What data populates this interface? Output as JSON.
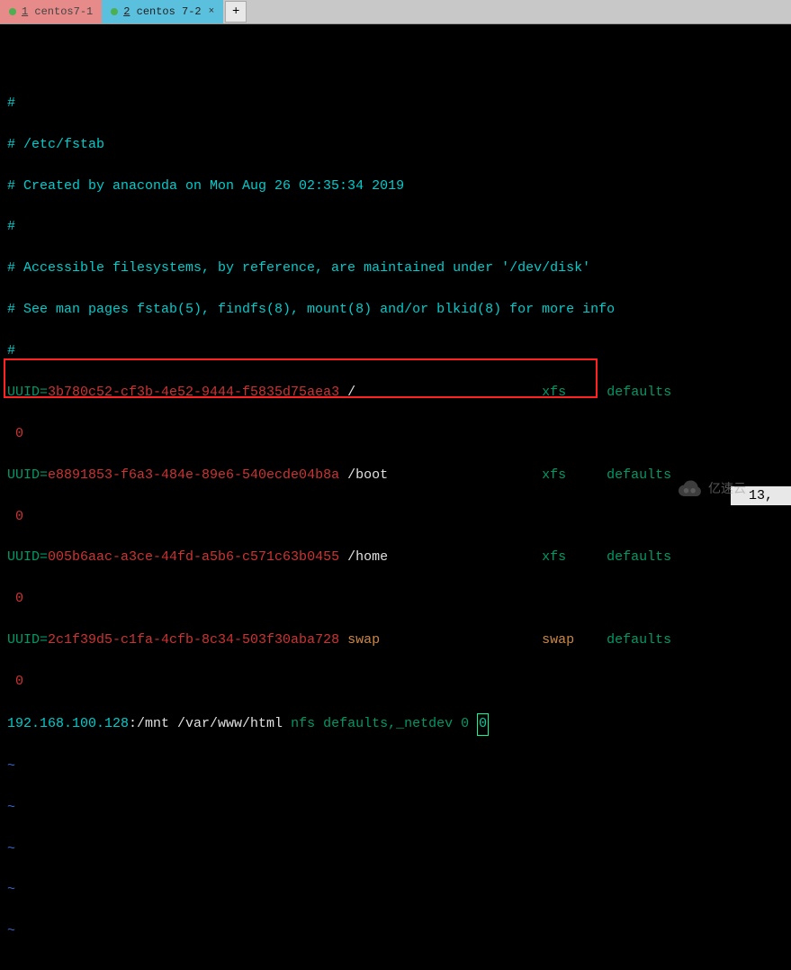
{
  "tabs": {
    "inactive": {
      "num": "1",
      "label": " centos7-1"
    },
    "active": {
      "num": "2",
      "label": " centos 7-2"
    },
    "add": "+"
  },
  "fstab": {
    "h1": "#",
    "h2": "# /etc/fstab",
    "h3": "# Created by anaconda on Mon Aug 26 02:35:34 2019",
    "h4": "#",
    "h5": "# Accessible filesystems, by reference, are maintained under '/dev/disk'",
    "h6": "# See man pages fstab(5), findfs(8), mount(8) and/or blkid(8) for more info",
    "h7": "#",
    "uuid_lbl": "UUID=",
    "e1": {
      "uuid": "3b780c52-cf3b-4e52-9444-f5835d75aea3",
      "mp": "/",
      "fs": "xfs",
      "opts": "defaults",
      "tail": " 0"
    },
    "e2": {
      "uuid": "e8891853-f6a3-484e-89e6-540ecde04b8a",
      "mp": "/boot",
      "fs": "xfs",
      "opts": "defaults",
      "tail": " 0"
    },
    "e3": {
      "uuid": "005b6aac-a3ce-44fd-a5b6-c571c63b0455",
      "mp": "/home",
      "fs": "xfs",
      "opts": "defaults",
      "tail": " 0"
    },
    "e4": {
      "uuid": "2c1f39d5-c1fa-4cfb-8c34-503f30aba728",
      "mp": "swap",
      "fs": "swap",
      "opts": "defaults",
      "tail": " 0"
    },
    "nfs": {
      "host": "192.168.100.128",
      "path": ":/mnt /var/www/html ",
      "fs": "nfs ",
      "opts": "defaults,_netdev 0 ",
      "last": "0"
    }
  },
  "tilde": "~",
  "status": "13,",
  "watermark": "亿速云"
}
